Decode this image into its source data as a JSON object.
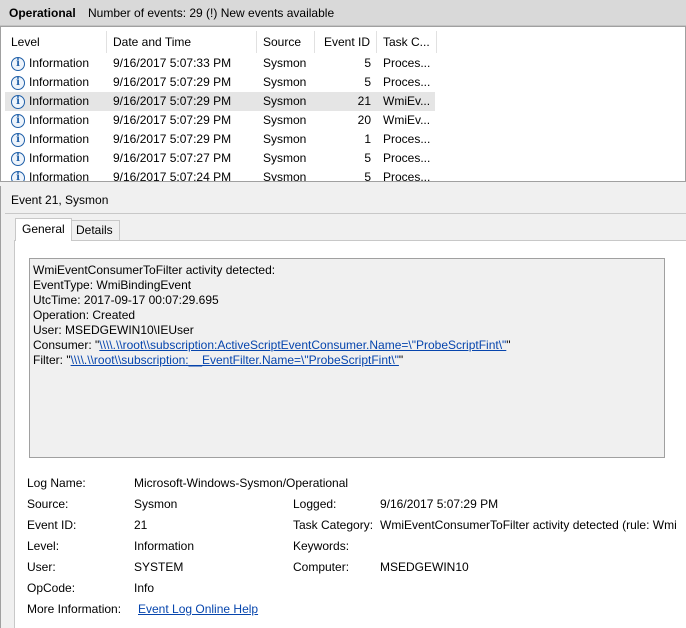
{
  "header": {
    "title": "Operational",
    "event_count": "Number of events: 29 (!) New events available"
  },
  "table": {
    "columns": [
      "Level",
      "Date and Time",
      "Source",
      "Event ID",
      "Task C..."
    ],
    "rows": [
      {
        "level": "Information",
        "date": "9/16/2017 5:07:33 PM",
        "source": "Sysmon",
        "id": "5",
        "task": "Proces..."
      },
      {
        "level": "Information",
        "date": "9/16/2017 5:07:29 PM",
        "source": "Sysmon",
        "id": "5",
        "task": "Proces..."
      },
      {
        "level": "Information",
        "date": "9/16/2017 5:07:29 PM",
        "source": "Sysmon",
        "id": "21",
        "task": "WmiEv..."
      },
      {
        "level": "Information",
        "date": "9/16/2017 5:07:29 PM",
        "source": "Sysmon",
        "id": "20",
        "task": "WmiEv..."
      },
      {
        "level": "Information",
        "date": "9/16/2017 5:07:29 PM",
        "source": "Sysmon",
        "id": "1",
        "task": "Proces..."
      },
      {
        "level": "Information",
        "date": "9/16/2017 5:07:27 PM",
        "source": "Sysmon",
        "id": "5",
        "task": "Proces..."
      },
      {
        "level": "Information",
        "date": "9/16/2017 5:07:24 PM",
        "source": "Sysmon",
        "id": "5",
        "task": "Proces..."
      }
    ],
    "selected_index": 2
  },
  "detail": {
    "title": "Event 21, Sysmon",
    "tabs": [
      "General",
      "Details"
    ],
    "active_tab": "General",
    "message": {
      "line1": "WmiEventConsumerToFilter activity detected:",
      "line2": "EventType: WmiBindingEvent",
      "line3": "UtcTime: 2017-09-17 00:07:29.695",
      "line4": "Operation: Created",
      "line5": "User: MSEDGEWIN10\\IEUser",
      "consumer_label": "Consumer:  \"",
      "consumer_link": "\\\\\\\\.\\\\root\\\\subscription:ActiveScriptEventConsumer.Name=\\\"ProbeScriptFint\\\"",
      "consumer_end": "\"",
      "filter_label": "Filter:  \"",
      "filter_link": "\\\\\\\\.\\\\root\\\\subscription:__EventFilter.Name=\\\"ProbeScriptFint\\\"",
      "filter_end": "\""
    },
    "props": {
      "log_name_label": "Log Name:",
      "log_name": "Microsoft-Windows-Sysmon/Operational",
      "source_label": "Source:",
      "source": "Sysmon",
      "logged_label": "Logged:",
      "logged": "9/16/2017 5:07:29 PM",
      "event_id_label": "Event ID:",
      "event_id": "21",
      "task_category_label": "Task Category:",
      "task_category": "WmiEventConsumerToFilter activity detected (rule: Wmi",
      "level_label": "Level:",
      "level": "Information",
      "keywords_label": "Keywords:",
      "keywords": "",
      "user_label": "User:",
      "user": "SYSTEM",
      "computer_label": "Computer:",
      "computer": "MSEDGEWIN10",
      "opcode_label": "OpCode:",
      "opcode": "Info",
      "more_info_label": "More Information:",
      "more_info_link": "Event Log Online Help"
    }
  }
}
